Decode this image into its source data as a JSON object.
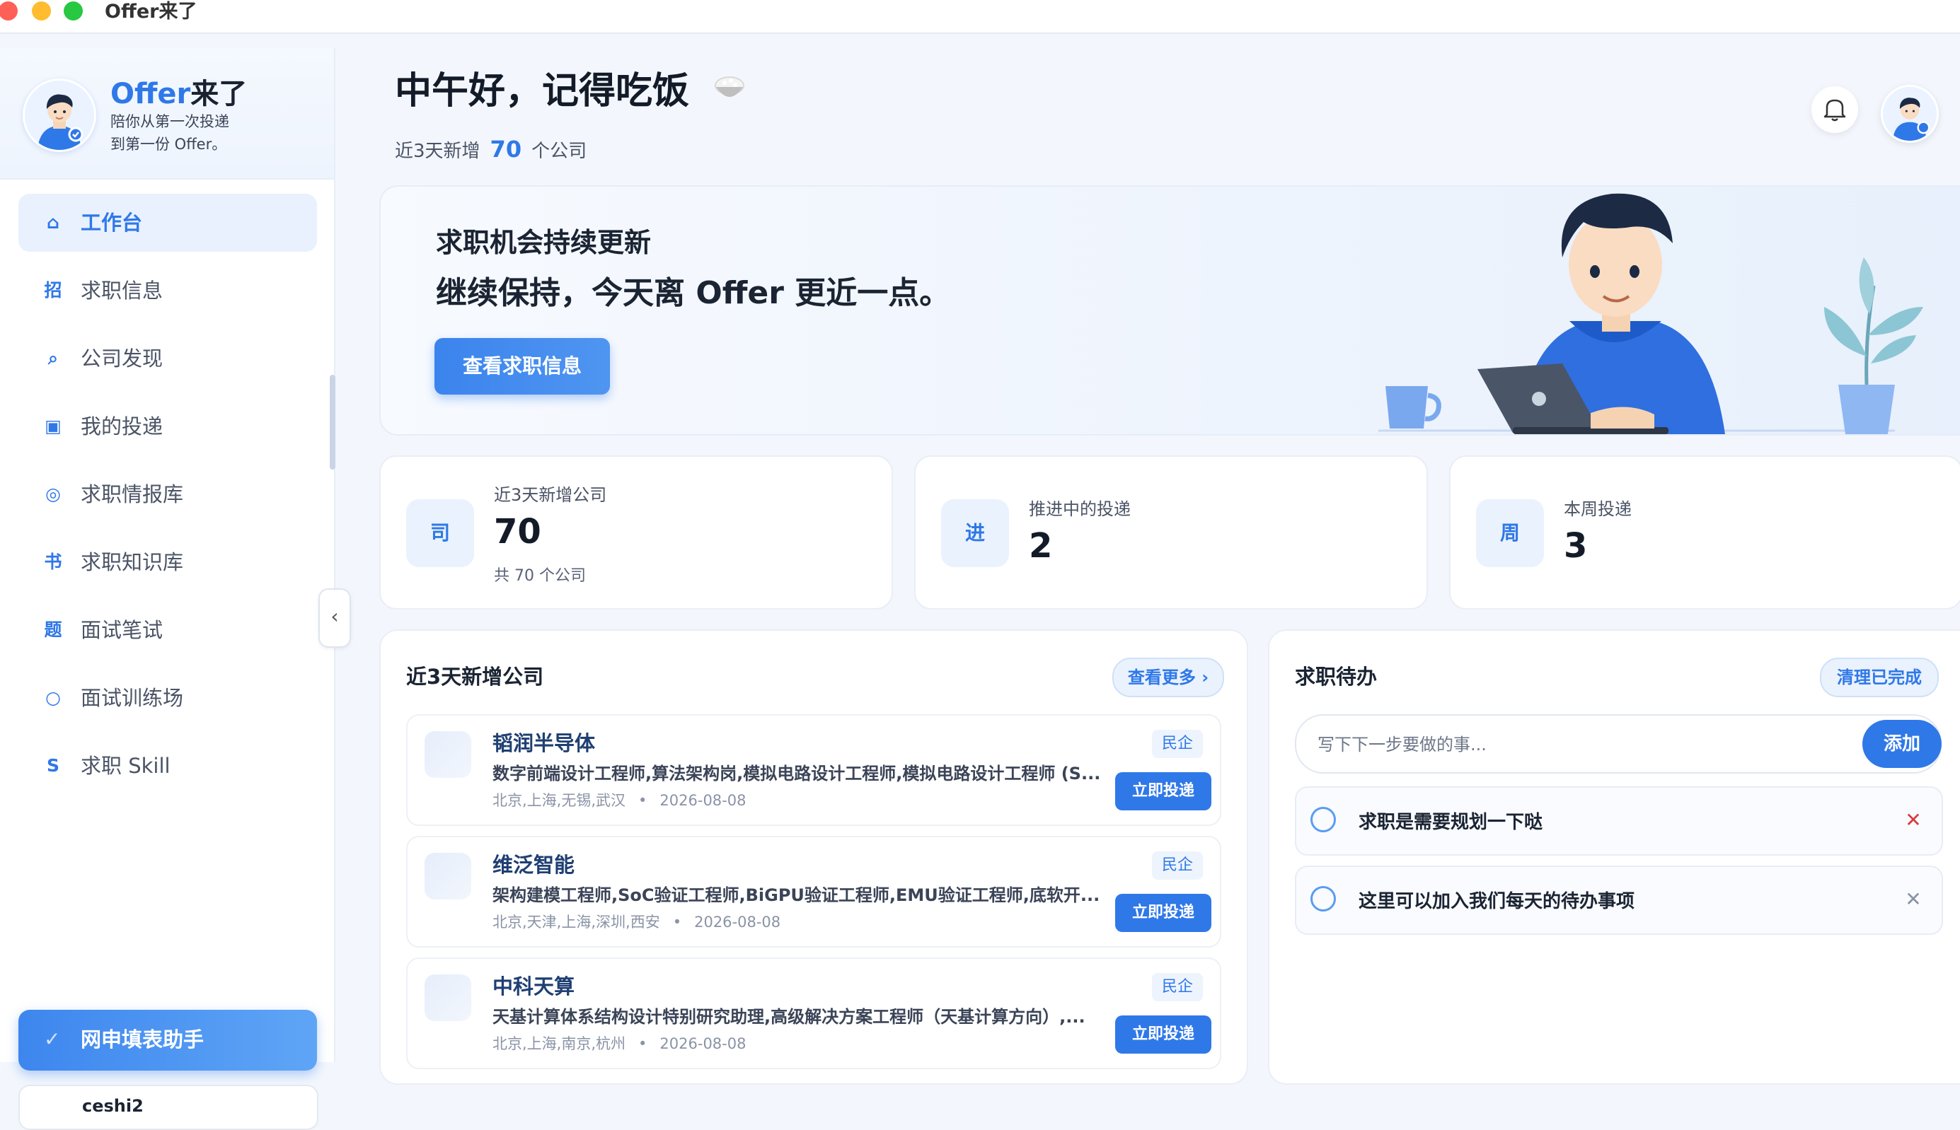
{
  "window": {
    "title": "Offer来了"
  },
  "brand": {
    "name_accent": "Offer",
    "name_rest": "来了",
    "tagline_1": "陪你从第一次投递",
    "tagline_2": "到第一份 Offer。"
  },
  "sidebar": {
    "items": [
      {
        "icon": "⌂",
        "icon_name": "home-icon",
        "label": "工作台",
        "active": true
      },
      {
        "icon": "招",
        "icon_name": "recruit-icon",
        "label": "求职信息"
      },
      {
        "icon": "⌕",
        "icon_name": "search-icon",
        "label": "公司发现"
      },
      {
        "icon": "▣",
        "icon_name": "box-icon",
        "label": "我的投递"
      },
      {
        "icon": "◎",
        "icon_name": "target-icon",
        "label": "求职情报库"
      },
      {
        "icon": "书",
        "icon_name": "book-icon",
        "label": "求职知识库"
      },
      {
        "icon": "题",
        "icon_name": "question-icon",
        "label": "面试笔试"
      },
      {
        "icon": "○",
        "icon_name": "circle-icon",
        "label": "面试训练场"
      },
      {
        "icon": "S",
        "icon_name": "skill-icon",
        "label": "求职 Skill"
      }
    ],
    "collapse_icon": "‹",
    "helper": {
      "icon": "✓",
      "label": "网申填表助手"
    },
    "user": {
      "name": "ceshi2"
    }
  },
  "greeting": {
    "title": "中午好，记得吃饭",
    "sub_prefix": "近3天新增",
    "count": "70",
    "sub_suffix": "个公司"
  },
  "hero": {
    "line1": "求职机会持续更新",
    "line2": "继续保持，今天离 Offer 更近一点。",
    "button": "查看求职信息"
  },
  "stats": [
    {
      "icon": "司",
      "label": "近3天新增公司",
      "value": "70",
      "note": "共 70 个公司"
    },
    {
      "icon": "进",
      "label": "推进中的投递",
      "value": "2"
    },
    {
      "icon": "周",
      "label": "本周投递",
      "value": "3"
    }
  ],
  "companies_panel": {
    "title": "近3天新增公司",
    "more": "查看更多 ›",
    "items": [
      {
        "name": "韬润半导体",
        "jobs": "数字前端设计工程师,算法架构岗,模拟电路设计工程师,模拟电路设计工程师 (S...",
        "locations": "北京,上海,无锡,武汉",
        "date": "2026-08-08",
        "tag": "民企",
        "apply": "立即投递"
      },
      {
        "name": "维泛智能",
        "jobs": "架构建模工程师,SoC验证工程师,BiGPU验证工程师,EMU验证工程师,底软开...",
        "locations": "北京,天津,上海,深圳,西安",
        "date": "2026-08-08",
        "tag": "民企",
        "apply": "立即投递"
      },
      {
        "name": "中科天算",
        "jobs": "天基计算体系结构设计特别研究助理,高级解决方案工程师（天基计算方向）,...",
        "locations": "北京,上海,南京,杭州",
        "date": "2026-08-08",
        "tag": "民企",
        "apply": "立即投递"
      }
    ]
  },
  "todo_panel": {
    "title": "求职待办",
    "clear": "清理已完成",
    "placeholder": "写下下一步要做的事...",
    "add": "添加",
    "items": [
      {
        "text": "求职是需要规划一下哒",
        "delete_color": "#d93a3a"
      },
      {
        "text": "这里可以加入我们每天的待办事项",
        "delete_color": "#8a93a6"
      }
    ]
  }
}
